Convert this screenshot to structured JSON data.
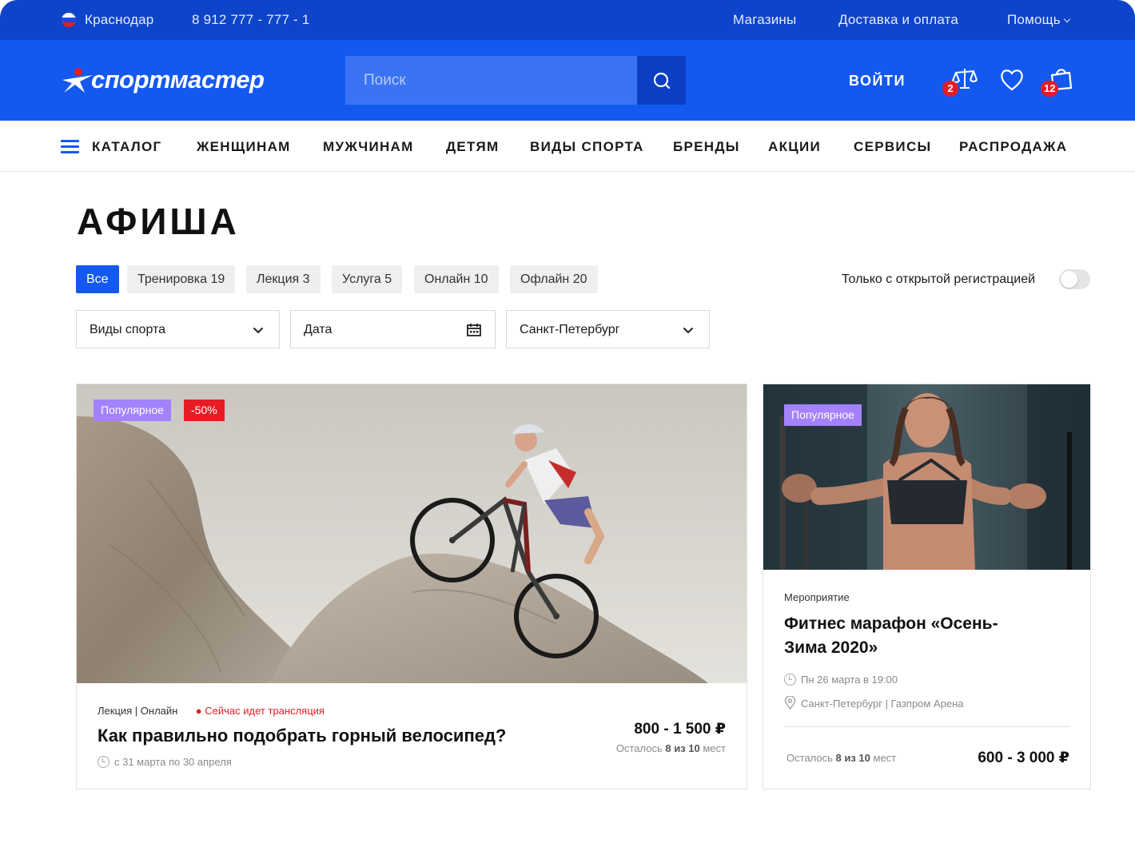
{
  "topbar": {
    "city": "Краснодар",
    "phone": "8 912 777 - 777 - 1",
    "links": [
      "Магазины",
      "Доставка и оплата",
      "Помощь"
    ]
  },
  "header": {
    "logo_text": "спортмастер",
    "search_placeholder": "Поиск",
    "login": "ВОЙТИ",
    "compare_count": "2",
    "cart_count": "12"
  },
  "nav": {
    "catalog": "КАТАЛОГ",
    "items": [
      "ЖЕНЩИНАМ",
      "МУЖЧИНАМ",
      "ДЕТЯМ",
      "ВИДЫ СПОРТА",
      "БРЕНДЫ",
      "АКЦИИ",
      "СЕРВИСЫ",
      "РАСПРОДАЖА"
    ]
  },
  "page_title": "АФИША",
  "filters": {
    "chips": [
      "Все",
      "Тренировка 19",
      "Лекция 3",
      "Услуга 5",
      "Онлайн 10",
      "Офлайн 20"
    ],
    "active_chip": "Все",
    "toggle_label": "Только с открытой регистрацией",
    "sport_select": "Виды спорта",
    "date_select": "Дата",
    "city_select": "Санкт-Петербург"
  },
  "cards": [
    {
      "tags": [
        "Популярное",
        "-50%"
      ],
      "meta": "Лекция | Онлайн",
      "live": "Сейчас идет трансляция",
      "title": "Как правильно подобрать горный велосипед?",
      "date": "с 31 марта по 30 апреля",
      "price": "800 - 1 500 ₽",
      "places_prefix": "Осталось",
      "places_value": "8 из 10",
      "places_suffix": "мест"
    },
    {
      "tags": [
        "Популярное"
      ],
      "meta": "Мероприятие",
      "title_line1": "Фитнес марафон «Осень-",
      "title_line2": "Зима 2020»",
      "date": "Пн 26 марта в 19:00",
      "location": "Санкт-Петербург | Газпром Арена",
      "places_prefix": "Осталось",
      "places_value": "8 из 10",
      "places_suffix": "мест",
      "price": "600 - 3 000 ₽"
    }
  ],
  "colors": {
    "topbar": "#0d44c9",
    "header": "#1359f0",
    "accent": "#1359f0",
    "popular_tag": "#a482ff",
    "sale_red": "#e61c24"
  }
}
